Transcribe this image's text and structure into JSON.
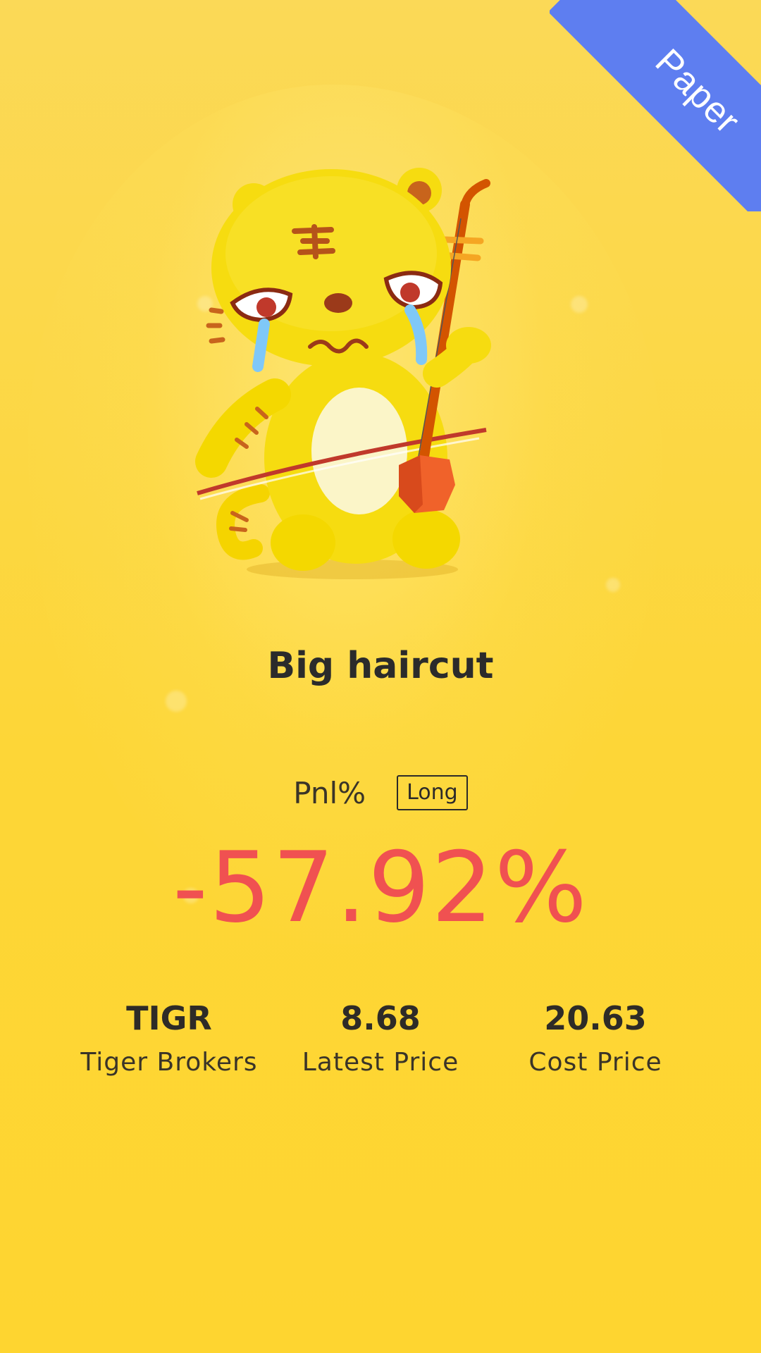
{
  "ribbon": {
    "label": "Paper",
    "color": "#5e7ef0"
  },
  "mascot": {
    "icon": "crying-tiger-playing-erhu-icon"
  },
  "headline": "Big haircut",
  "pnl": {
    "label": "Pnl%",
    "direction_badge": "Long",
    "value": "-57.92%",
    "value_color": "#f05151"
  },
  "stats": [
    {
      "value": "TIGR",
      "label": "Tiger Brokers"
    },
    {
      "value": "8.68",
      "label": "Latest Price"
    },
    {
      "value": "20.63",
      "label": "Cost Price"
    }
  ]
}
